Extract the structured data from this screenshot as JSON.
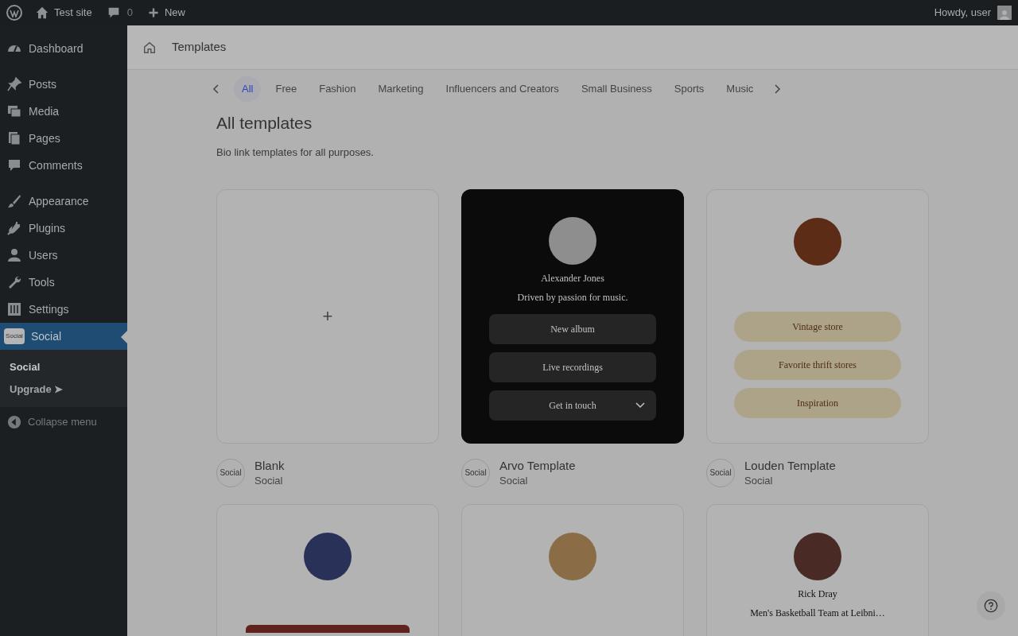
{
  "admin_bar": {
    "site": "Test site",
    "comments": "0",
    "new": "New",
    "greeting": "Howdy, user"
  },
  "sidebar": {
    "groups": [
      [
        {
          "label": "Dashboard",
          "selected": false
        }
      ],
      [
        {
          "label": "Posts",
          "selected": false
        },
        {
          "label": "Media",
          "selected": false
        },
        {
          "label": "Pages",
          "selected": false
        },
        {
          "label": "Comments",
          "selected": false
        }
      ],
      [
        {
          "label": "Appearance",
          "selected": false
        },
        {
          "label": "Plugins",
          "selected": false
        },
        {
          "label": "Users",
          "selected": false
        },
        {
          "label": "Tools",
          "selected": false
        },
        {
          "label": "Settings",
          "selected": false
        },
        {
          "label": "Social",
          "selected": true
        }
      ]
    ],
    "submenu": [
      {
        "label": "Social",
        "selected": true
      },
      {
        "label": "Upgrade ➤",
        "selected": false
      }
    ],
    "collapse": "Collapse menu",
    "logo_text": "Social"
  },
  "header": {
    "title": "Templates"
  },
  "categories": [
    {
      "label": "All",
      "selected": true
    },
    {
      "label": "Free",
      "selected": false
    },
    {
      "label": "Fashion",
      "selected": false
    },
    {
      "label": "Marketing",
      "selected": false
    },
    {
      "label": "Influencers and Creators",
      "selected": false
    },
    {
      "label": "Small Business",
      "selected": false
    },
    {
      "label": "Sports",
      "selected": false
    },
    {
      "label": "Music",
      "selected": false
    }
  ],
  "section": {
    "title": "All templates",
    "description": "Bio link templates for all purposes."
  },
  "templates": [
    {
      "kind": "blank",
      "name": "Blank",
      "source": "Social",
      "badge": "Social",
      "plus": "+"
    },
    {
      "kind": "dark",
      "name": "Arvo Template",
      "source": "Social",
      "badge": "Social",
      "profile": "Alexander Jones",
      "bio": "Driven by passion for music.",
      "links": [
        {
          "label": "New album",
          "dropdown": false
        },
        {
          "label": "Live recordings",
          "dropdown": false
        },
        {
          "label": "Get in touch",
          "dropdown": true
        }
      ]
    },
    {
      "kind": "paper",
      "name": "Louden Template",
      "source": "Social",
      "badge": "Social",
      "links": [
        {
          "label": "Vintage store",
          "dropdown": false
        },
        {
          "label": "Favorite thrift stores",
          "dropdown": false
        },
        {
          "label": "Inspiration",
          "dropdown": false
        }
      ]
    },
    {
      "kind": "photo"
    },
    {
      "kind": "logo"
    },
    {
      "kind": "profile",
      "profile": "Rick Dray",
      "bio": "Men's Basketball Team at Leibni…"
    }
  ]
}
